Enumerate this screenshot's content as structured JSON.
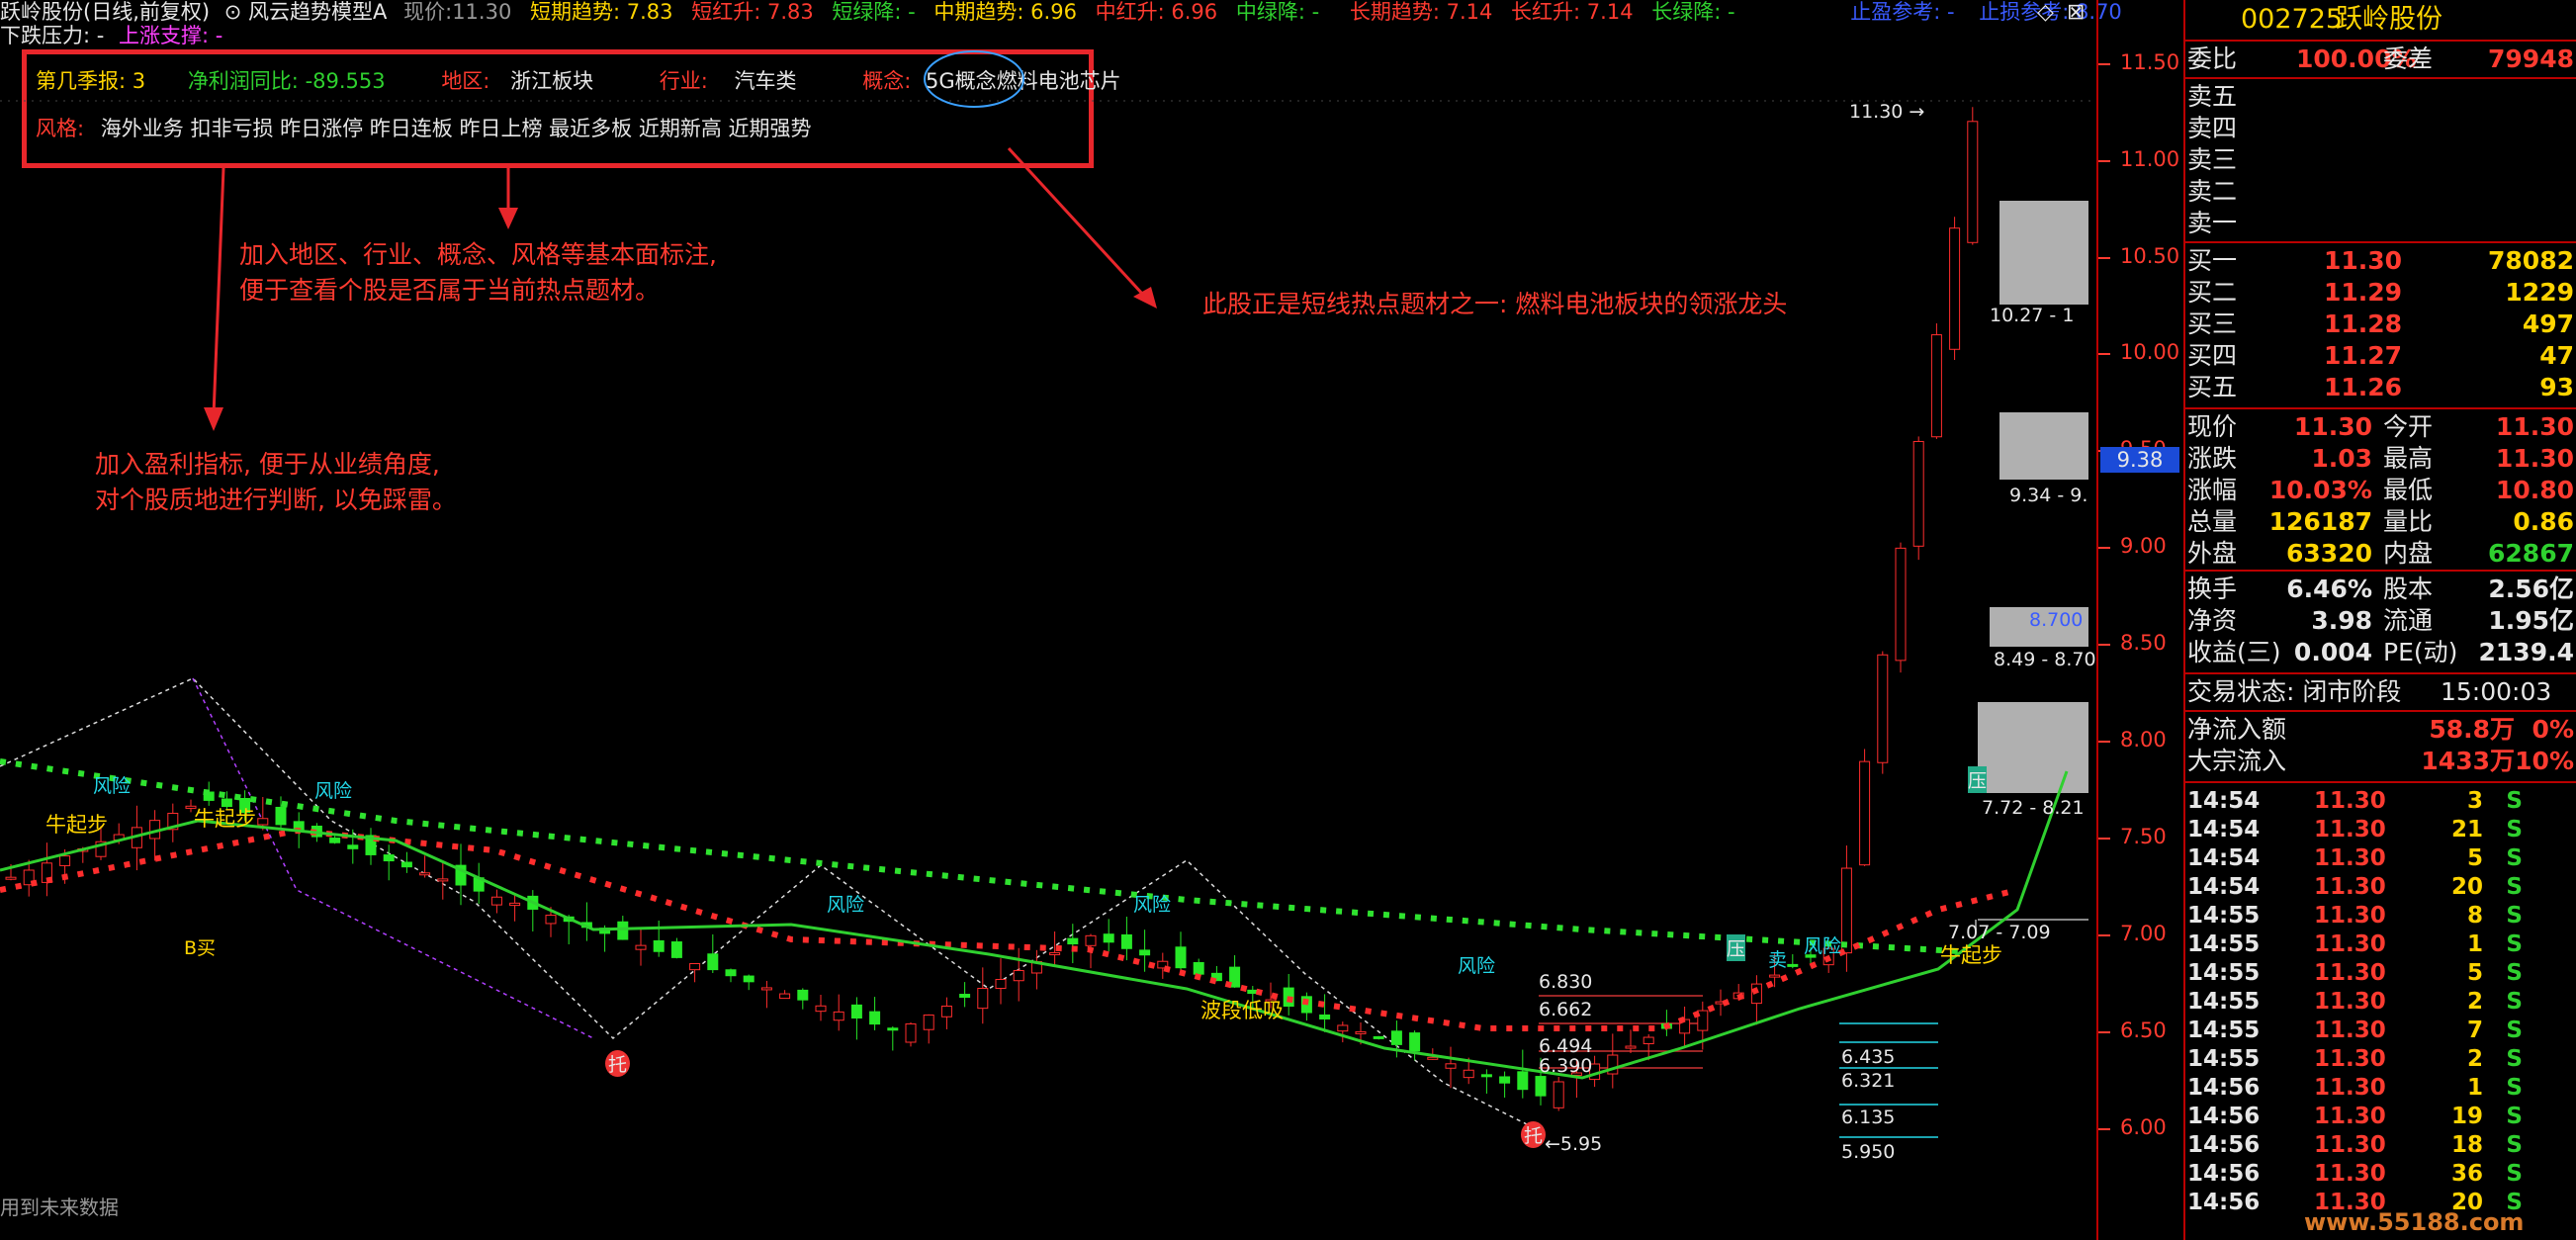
{
  "header": {
    "stock_title": "跃岭股份(日线,前复权)",
    "indicator_name": "风云趋势模型A",
    "now_label": "现价:",
    "now_value": "11.30",
    "short_trend": "短期趋势: 7.83",
    "short_red": "短红升: 7.83",
    "short_green": "短绿降: -",
    "mid_trend": "中期趋势: 6.96",
    "mid_red": "中红升: 6.96",
    "mid_green": "中绿降: -",
    "long_trend": "长期趋势: 7.14",
    "long_red": "长红升: 7.14",
    "long_green": "长绿降: -",
    "take_profit": "止盈参考: -",
    "stop_loss": "止损参考: 8.70",
    "down_pressure": "下跌压力: -",
    "up_support": "上涨支撑: -"
  },
  "infobox": {
    "season_label": "第几季报: 3",
    "profit_label": "净利润同比: -89.553",
    "region_label": "地区:",
    "region_value": "浙江板块",
    "industry_label": "行业:",
    "industry_value": "汽车类",
    "concept_label": "概念:",
    "concept_items": [
      "5G概念",
      "燃料电池",
      "芯片"
    ],
    "style_label": "风格:",
    "style_value": "海外业务 扣非亏损 昨日涨停 昨日连板 昨日上榜 最近多板 近期新高 近期强势"
  },
  "annotations": {
    "a1_line1": "加入地区、行业、概念、风格等基本面标注,",
    "a1_line2": "便于查看个股是否属于当前热点题材。",
    "a2_line1": "加入盈利指标, 便于从业绩角度,",
    "a2_line2": "对个股质地进行判断, 以免踩雷。",
    "a3": "此股正是短线热点题材之一: 燃料电池板块的领涨龙头"
  },
  "chart_labels": {
    "fengxian": "风险",
    "niu_qibu": "牛起步",
    "b_mai": "B买",
    "mai": "卖",
    "ya": "压",
    "tuo": "托",
    "boduan": "波段低吸",
    "fib": [
      "6.830",
      "6.662",
      "6.494",
      "6.390",
      "6.435",
      "6.321",
      "6.135",
      "5.950"
    ],
    "low_mark": "←5.95",
    "high_mark": "11.30 →",
    "zone_labels": [
      "10.27 - 1",
      "9.34 - 9.",
      "8.700",
      "8.49 - 8.70",
      "7.72 - 8.21",
      "7.07 - 7.09"
    ],
    "future_note": "用到未来数据"
  },
  "price_axis": {
    "ticks": [
      "11.50",
      "11.00",
      "10.50",
      "10.00",
      "9.50",
      "9.00",
      "8.50",
      "8.00",
      "7.50",
      "7.00",
      "6.50",
      "6.00"
    ],
    "current": "9.38"
  },
  "panel": {
    "code": "002725",
    "name": "跃岭股份",
    "weibi_label": "委比",
    "weibi_value": "100.00%",
    "weicha_label": "委差",
    "weicha_value": "79948",
    "sell": [
      "卖五",
      "卖四",
      "卖三",
      "卖二",
      "卖一"
    ],
    "buy": [
      {
        "label": "买一",
        "price": "11.30",
        "vol": "78082"
      },
      {
        "label": "买二",
        "price": "11.29",
        "vol": "1229"
      },
      {
        "label": "买三",
        "price": "11.28",
        "vol": "497"
      },
      {
        "label": "买四",
        "price": "11.27",
        "vol": "47"
      },
      {
        "label": "买五",
        "price": "11.26",
        "vol": "93"
      }
    ],
    "stats": [
      {
        "l1": "现价",
        "v1": "11.30",
        "l2": "今开",
        "v2": "11.30"
      },
      {
        "l1": "涨跌",
        "v1": "1.03",
        "l2": "最高",
        "v2": "11.30"
      },
      {
        "l1": "涨幅",
        "v1": "10.03%",
        "l2": "最低",
        "v2": "10.80"
      },
      {
        "l1": "总量",
        "v1": "126187",
        "l2": "量比",
        "v2": "0.86"
      },
      {
        "l1": "外盘",
        "v1": "63320",
        "l2": "内盘",
        "v2": "62867"
      }
    ],
    "stats2": [
      {
        "l1": "换手",
        "v1": "6.46%",
        "l2": "股本",
        "v2": "2.56亿"
      },
      {
        "l1": "净资",
        "v1": "3.98",
        "l2": "流通",
        "v2": "1.95亿"
      },
      {
        "l1": "收益(三)",
        "v1": "0.004",
        "l2": "PE(动)",
        "v2": "2139.4"
      }
    ],
    "trade_status": "交易状态: 闭市阶段",
    "trade_time": "15:00:03",
    "flow": [
      {
        "label": "净流入额",
        "value": "58.8万",
        "pct": "0%"
      },
      {
        "label": "大宗流入",
        "value": "1433万",
        "pct": "10%"
      }
    ],
    "ticks": [
      {
        "t": "14:54",
        "p": "11.30",
        "v": "3",
        "s": "S"
      },
      {
        "t": "14:54",
        "p": "11.30",
        "v": "21",
        "s": "S"
      },
      {
        "t": "14:54",
        "p": "11.30",
        "v": "5",
        "s": "S"
      },
      {
        "t": "14:54",
        "p": "11.30",
        "v": "20",
        "s": "S"
      },
      {
        "t": "14:55",
        "p": "11.30",
        "v": "8",
        "s": "S"
      },
      {
        "t": "14:55",
        "p": "11.30",
        "v": "1",
        "s": "S"
      },
      {
        "t": "14:55",
        "p": "11.30",
        "v": "5",
        "s": "S"
      },
      {
        "t": "14:55",
        "p": "11.30",
        "v": "2",
        "s": "S"
      },
      {
        "t": "14:55",
        "p": "11.30",
        "v": "7",
        "s": "S"
      },
      {
        "t": "14:55",
        "p": "11.30",
        "v": "2",
        "s": "S"
      },
      {
        "t": "14:56",
        "p": "11.30",
        "v": "1",
        "s": "S"
      },
      {
        "t": "14:56",
        "p": "11.30",
        "v": "19",
        "s": "S"
      },
      {
        "t": "14:56",
        "p": "11.30",
        "v": "18",
        "s": "S"
      },
      {
        "t": "14:56",
        "p": "11.30",
        "v": "36",
        "s": "S"
      },
      {
        "t": "14:56",
        "p": "11.30",
        "v": "20",
        "s": "S"
      }
    ],
    "watermark": "www.55188.com"
  }
}
